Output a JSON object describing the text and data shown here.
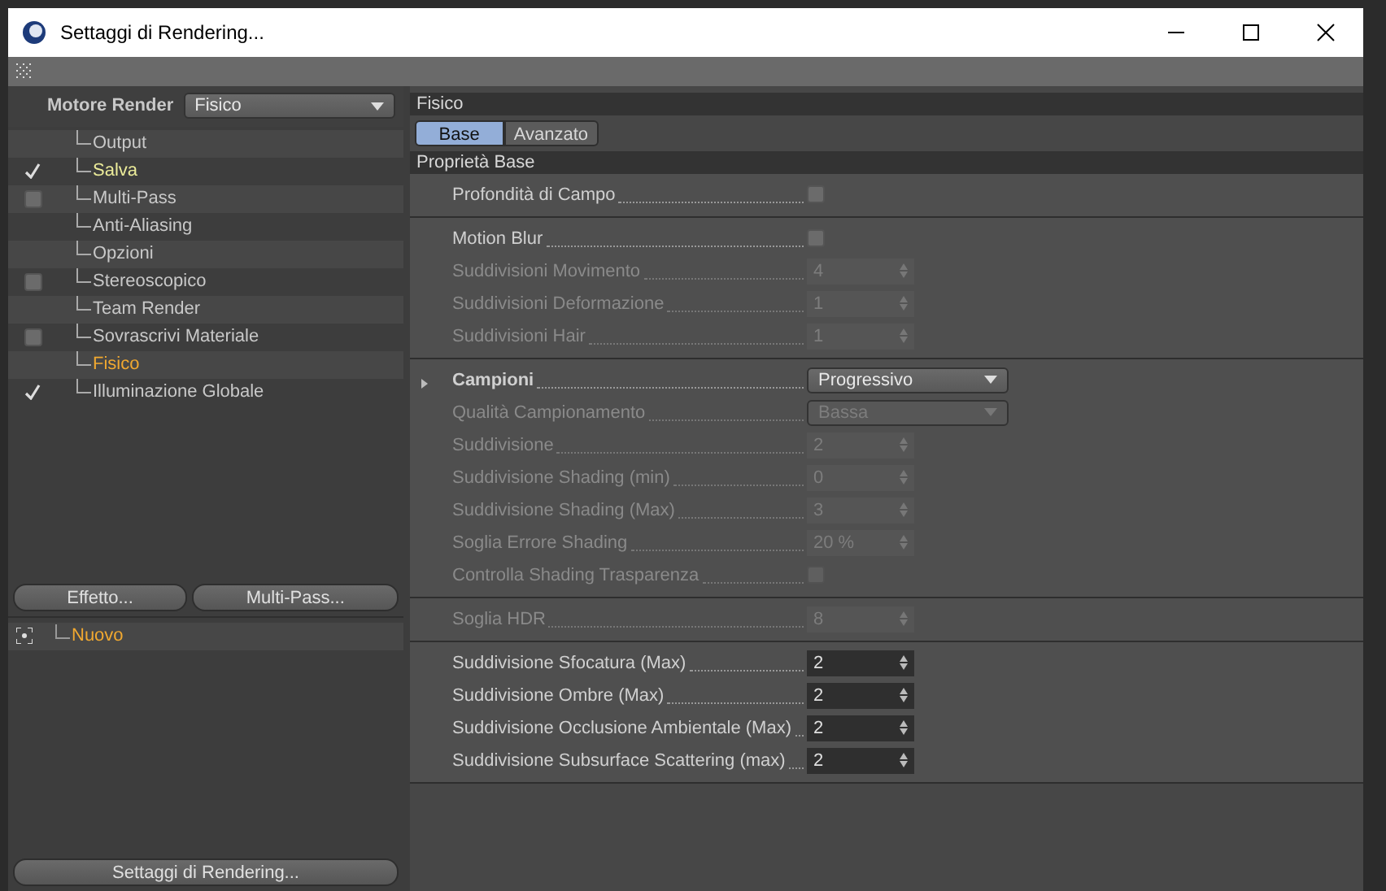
{
  "window": {
    "title": "Settaggi di Rendering..."
  },
  "renderer": {
    "label": "Motore Render",
    "value": "Fisico"
  },
  "sidebar": {
    "items": [
      {
        "label": "Output",
        "kind": "plain",
        "selected": false,
        "highlighted": false
      },
      {
        "label": "Salva",
        "kind": "checkbox",
        "checked": true,
        "selected": false,
        "highlighted": true
      },
      {
        "label": "Multi-Pass",
        "kind": "checkbox",
        "checked": false,
        "selected": false,
        "highlighted": false
      },
      {
        "label": "Anti-Aliasing",
        "kind": "plain",
        "selected": false,
        "highlighted": false
      },
      {
        "label": "Opzioni",
        "kind": "plain",
        "selected": false,
        "highlighted": false
      },
      {
        "label": "Stereoscopico",
        "kind": "checkbox",
        "checked": false,
        "selected": false,
        "highlighted": false
      },
      {
        "label": "Team Render",
        "kind": "plain",
        "selected": false,
        "highlighted": false
      },
      {
        "label": "Sovrascrivi Materiale",
        "kind": "checkbox",
        "checked": false,
        "selected": false,
        "highlighted": false
      },
      {
        "label": "Fisico",
        "kind": "plain",
        "selected": true,
        "highlighted": false
      },
      {
        "label": "Illuminazione Globale",
        "kind": "checkbox",
        "checked": true,
        "selected": false,
        "highlighted": false
      }
    ]
  },
  "effect_buttons": [
    "Effetto...",
    "Multi-Pass..."
  ],
  "presets": [
    {
      "label": "Nuovo",
      "selected": true
    }
  ],
  "footer_button": "Settaggi di Rendering...",
  "panel": {
    "title": "Fisico",
    "tabs": [
      {
        "label": "Base",
        "selected": true
      },
      {
        "label": "Avanzato",
        "selected": false
      }
    ],
    "section": "Proprietà Base",
    "groups": [
      [
        {
          "label": "Profondità di Campo",
          "kind": "checkbox",
          "checked": false,
          "disabled": false
        }
      ],
      [
        {
          "label": "Motion Blur",
          "kind": "checkbox",
          "checked": false,
          "disabled": false
        },
        {
          "label": "Suddivisioni Movimento",
          "kind": "number",
          "value": "4",
          "disabled": true
        },
        {
          "label": "Suddivisioni Deformazione",
          "kind": "number",
          "value": "1",
          "disabled": true
        },
        {
          "label": "Suddivisioni Hair",
          "kind": "number",
          "value": "1",
          "disabled": true
        }
      ],
      [
        {
          "label": "Campioni",
          "kind": "dropdown",
          "value": "Progressivo",
          "disabled": false,
          "expanded": false,
          "emphasis": true
        },
        {
          "label": "Qualità Campionamento",
          "kind": "dropdown",
          "value": "Bassa",
          "disabled": true
        },
        {
          "label": "Suddivisione",
          "kind": "number",
          "value": "2",
          "disabled": true
        },
        {
          "label": "Suddivisione Shading (min)",
          "kind": "number",
          "value": "0",
          "disabled": true
        },
        {
          "label": "Suddivisione Shading (Max)",
          "kind": "number",
          "value": "3",
          "disabled": true
        },
        {
          "label": "Soglia Errore Shading",
          "kind": "number",
          "value": "20 %",
          "disabled": true
        },
        {
          "label": "Controlla Shading Trasparenza",
          "kind": "checkbox",
          "checked": false,
          "disabled": true
        }
      ],
      [
        {
          "label": "Soglia HDR",
          "kind": "number",
          "value": "8",
          "disabled": true
        }
      ],
      [
        {
          "label": "Suddivisione Sfocatura (Max)",
          "kind": "number",
          "value": "2",
          "disabled": false
        },
        {
          "label": "Suddivisione Ombre (Max)",
          "kind": "number",
          "value": "2",
          "disabled": false
        },
        {
          "label": "Suddivisione Occlusione Ambientale (Max)",
          "kind": "number",
          "value": "2",
          "disabled": false
        },
        {
          "label": "Suddivisione Subsurface Scattering (max)",
          "kind": "number",
          "value": "2",
          "disabled": false
        }
      ]
    ]
  }
}
